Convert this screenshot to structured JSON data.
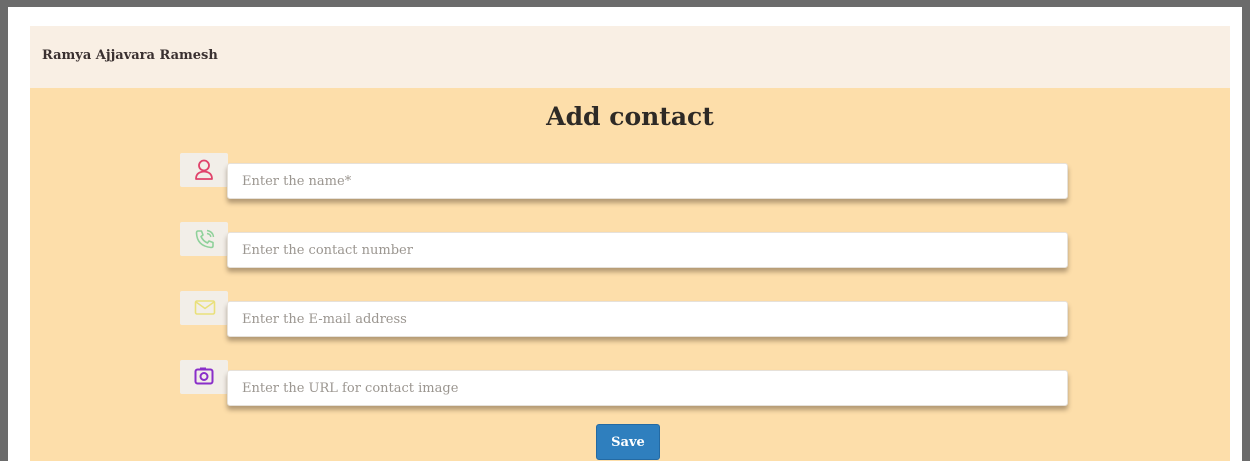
{
  "header": {
    "brand": "Ramya Ajjavara Ramesh"
  },
  "form": {
    "title": "Add contact",
    "fields": [
      {
        "icon": "person-icon",
        "placeholder": "Enter the name*",
        "value": ""
      },
      {
        "icon": "phone-icon",
        "placeholder": "Enter the contact number",
        "value": ""
      },
      {
        "icon": "envelope-icon",
        "placeholder": "Enter the E-mail address",
        "value": ""
      },
      {
        "icon": "camera-icon",
        "placeholder": "Enter the URL for contact image",
        "value": ""
      }
    ],
    "save_label": "Save"
  },
  "colors": {
    "page_background": "#fddeaa",
    "header_background": "#f9efe4",
    "save_button": "#2f7fbe",
    "person_icon": "#e0436b",
    "phone_icon": "#8fd19a",
    "envelope_icon": "#e9e07a",
    "camera_icon": "#8a2fc9"
  }
}
